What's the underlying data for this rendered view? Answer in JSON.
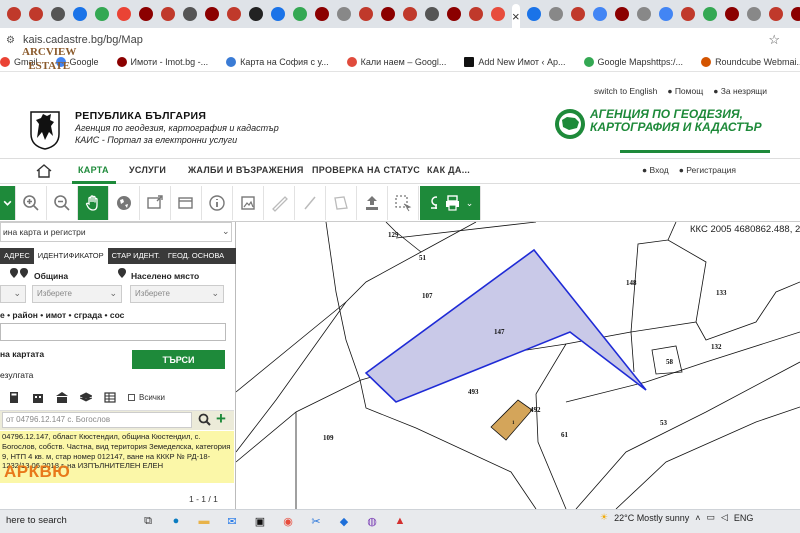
{
  "browser": {
    "active_tab_close": "×",
    "url": "kais.cadastre.bg/bg/Map",
    "bookmarks": [
      {
        "label": "Gmail",
        "color": "#ea4335"
      },
      {
        "label": "Google",
        "color": "#4285f4"
      },
      {
        "label": "Имоти - Imot.bg -...",
        "color": "#8b0000"
      },
      {
        "label": "Карта на София с у...",
        "color": "#3a7bd5"
      },
      {
        "label": "Кали наем – Googl...",
        "color": "#e04b3c"
      },
      {
        "label": "Add New Имот ‹ Ар...",
        "color": "#111111"
      },
      {
        "label": "Google Mapshttps:/...",
        "color": "#34a853"
      },
      {
        "label": "Roundcube Webmai...",
        "color": "#d35400"
      }
    ]
  },
  "watermark": {
    "top_line1": "ARCVIEW",
    "top_line2": "ESTATE",
    "bottom": "АРКВЮ"
  },
  "header": {
    "gov_title": "РЕПУБЛИКА БЪЛГАРИЯ",
    "agency": "Агенция по геодезия, картография и кадастър",
    "portal": "КАИС - Портал за електронни услуги",
    "switch_lang": "switch to English",
    "help": "Помощ",
    "deaf": "За незрящи",
    "logo_line1": "АГЕНЦИЯ ПО ГЕОДЕЗИЯ,",
    "logo_line2": "КАРТОГРАФИЯ И КАДАСТЪР"
  },
  "nav": {
    "items": [
      "КАРТА",
      "УСЛУГИ",
      "ЖАЛБИ И ВЪЗРАЖЕНИЯ",
      "ПРОВЕРКА НА СТАТУС",
      "КАК ДА..."
    ],
    "login": "Вход",
    "register": "Регистрация"
  },
  "toolbar": {
    "icons": [
      "expand-icon",
      "zoom-in-icon",
      "zoom-out-icon",
      "pan-hand-icon",
      "globe-icon",
      "export-icon",
      "window-icon",
      "info-icon",
      "gallery-icon",
      "measure-icon",
      "area-icon",
      "upload-icon",
      "select-icon",
      "layers-icon",
      "print-icon"
    ]
  },
  "panel": {
    "layer_select": "ина карта и регистри",
    "tabs": [
      "АДРЕС",
      "ИДЕНТИФИКАТОР",
      "СТАР ИДЕНТ.",
      "ГЕОД. ОСНОВА"
    ],
    "active_tab": 1,
    "label_municipality": "Община",
    "label_settlement": "Населено място",
    "placeholder_select": "Изберете",
    "search_label": "е • район • имот • сграда • сос",
    "on_map_label": "на картата",
    "search_button": "ТЪРСИ",
    "results_label": "езулгата",
    "all_label": "Всички",
    "result_title": "от 04796.12.147 с. Богослов",
    "result_info": "04796.12.147, област Кюстендил, община Кюстендил, с. Богослов, собств. Частна, вид територия Земеделска, категория 9, НТП 4 кв. м, стар номер 012147, ване на КККР № РД-18-1232/13.06.2018 г. на ИЗПЪЛНИТЕЛЕН ЕЛЕН",
    "pager": "1 - 1 / 1"
  },
  "map": {
    "coordinates": "ККС 2005 4680862.488, 20",
    "parcel_labels": [
      "129",
      "51",
      "107",
      "147",
      "148",
      "133",
      "132",
      "58",
      "493",
      "492",
      "61",
      "53",
      "109",
      "1"
    ],
    "highlight_fill": "#c9c9e8",
    "highlight_stroke": "#1f2bd6",
    "building_fill": "#d4a55a"
  },
  "taskbar": {
    "search_text": "here to search",
    "weather": "22°C  Mostly sunny",
    "lang": "ENG"
  }
}
